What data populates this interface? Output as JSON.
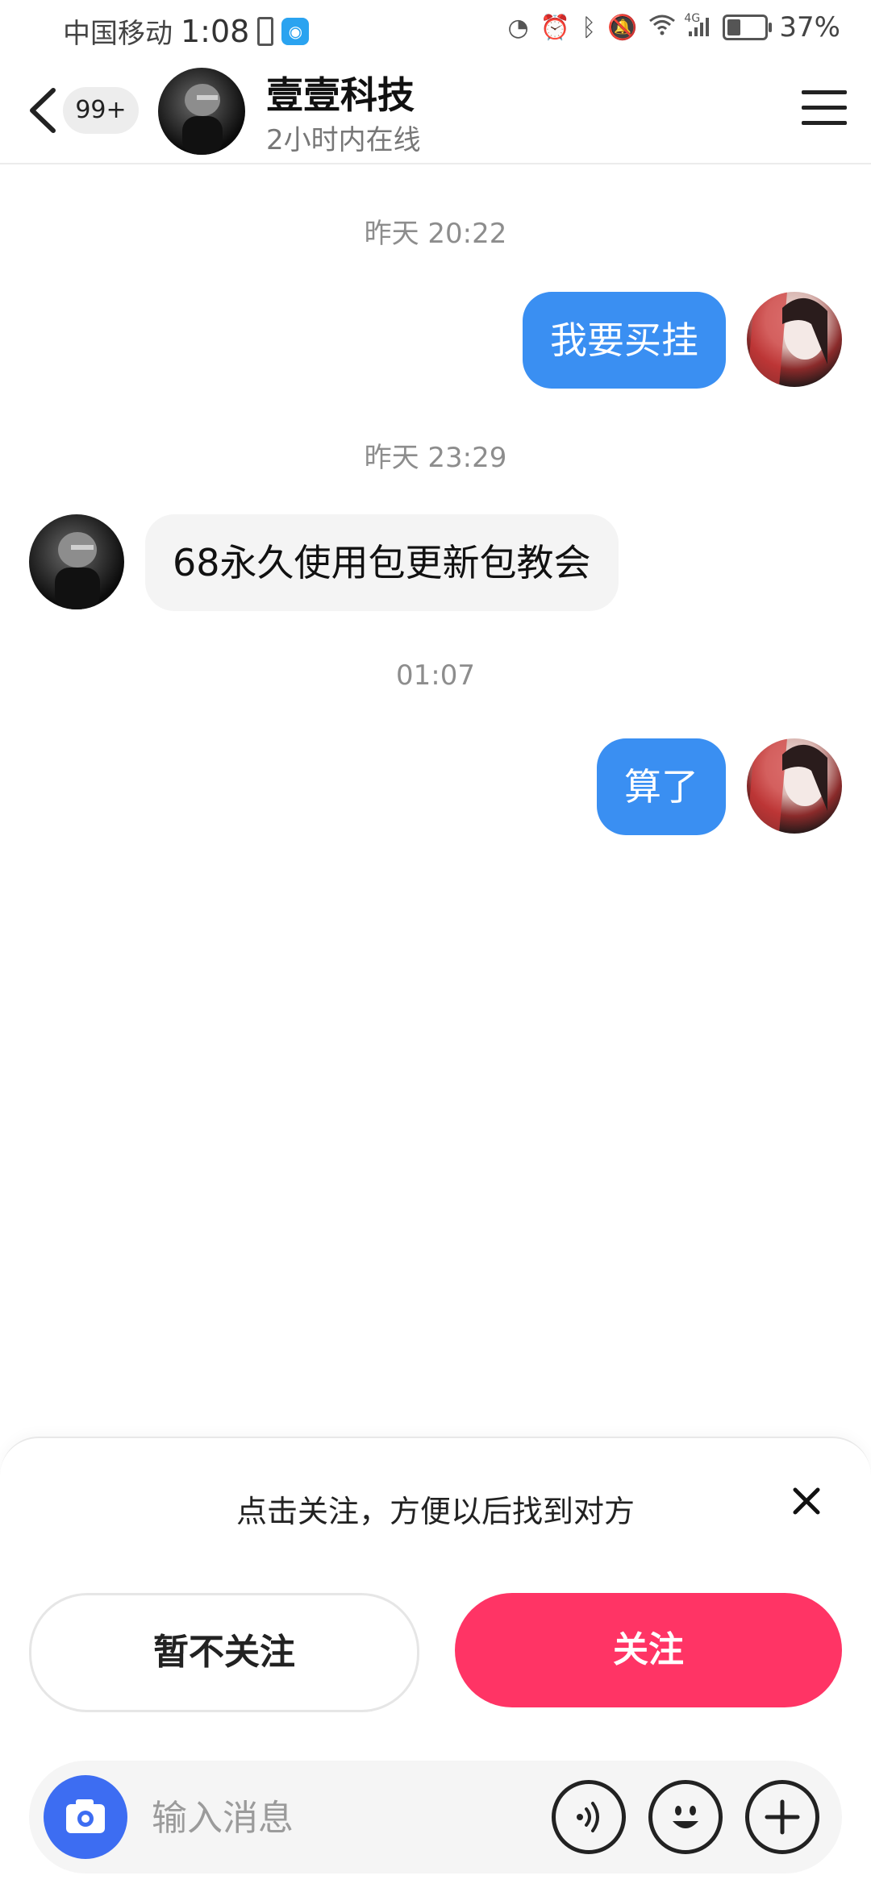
{
  "status_bar": {
    "carrier": "中国移动",
    "time": "1:08",
    "network": "4G",
    "battery_percent": "37%",
    "battery_level": 0.37
  },
  "header": {
    "back_icon": "chevron-left-icon",
    "unread_badge": "99+",
    "contact_name": "壹壹科技",
    "contact_status": "2小时内在线",
    "menu_icon": "hamburger-menu-icon"
  },
  "messages": [
    {
      "timestamp": "昨天 20:22",
      "sender": "me",
      "text": "我要买挂"
    },
    {
      "timestamp": "昨天 23:29",
      "sender": "other",
      "text": "68永久使用包更新包教会"
    },
    {
      "timestamp": "01:07",
      "sender": "me",
      "text": "算了"
    }
  ],
  "follow_prompt": {
    "text": "点击关注，方便以后找到对方",
    "dismiss_label": "暂不关注",
    "follow_label": "关注"
  },
  "input_bar": {
    "placeholder": "输入消息",
    "camera_icon": "camera-icon",
    "voice_icon": "voice-icon",
    "emoji_icon": "emoji-icon",
    "plus_icon": "plus-icon"
  },
  "colors": {
    "my_bubble": "#3a8ff2",
    "follow_button": "#ff3465",
    "camera_button": "#3d6df2"
  }
}
